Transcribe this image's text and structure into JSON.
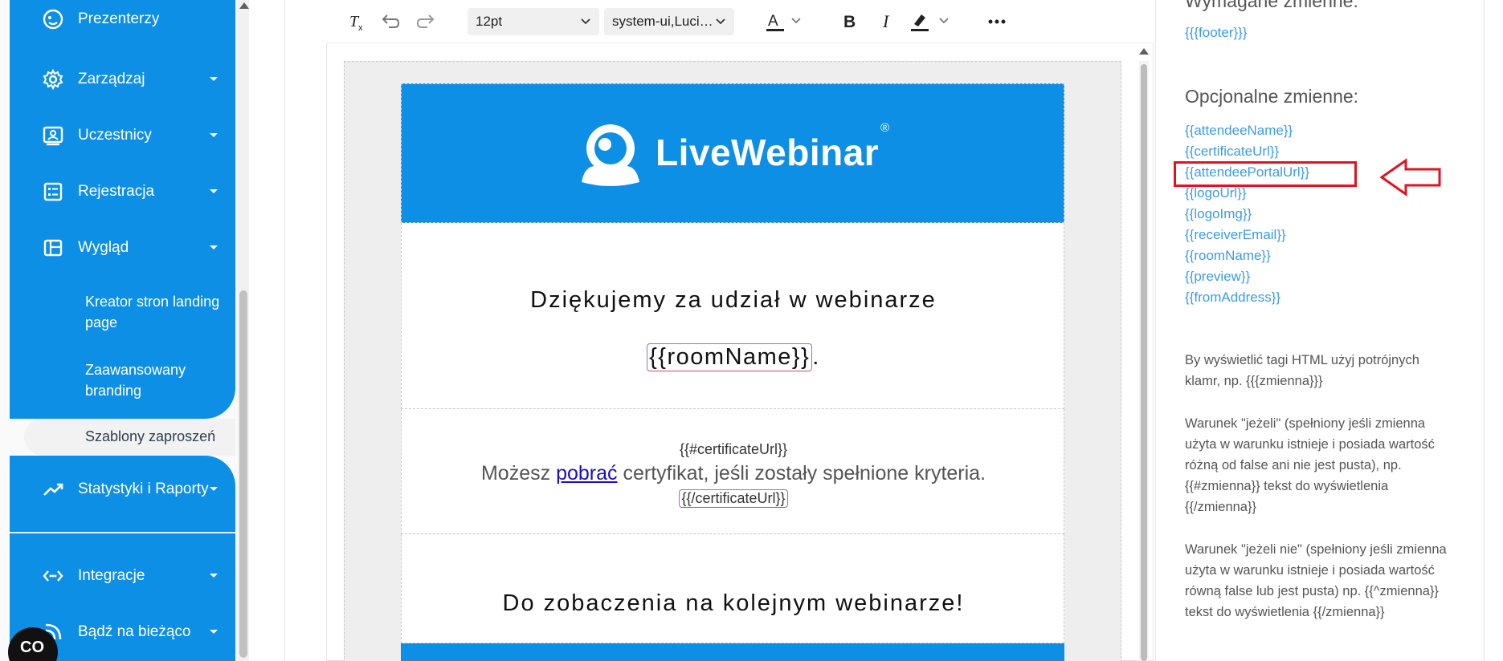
{
  "sidebar": {
    "items": [
      {
        "label": "Prezenterzy",
        "icon": "presenter-icon",
        "has_caret": false
      },
      {
        "label": "Zarządzaj",
        "icon": "gear-icon",
        "has_caret": true
      },
      {
        "label": "Uczestnicy",
        "icon": "participants-icon",
        "has_caret": true
      },
      {
        "label": "Rejestracja",
        "icon": "registration-form-icon",
        "has_caret": true
      },
      {
        "label": "Wygląd",
        "icon": "layout-icon",
        "has_caret": true
      }
    ],
    "subitems": [
      {
        "label": "Kreator stron landing page"
      },
      {
        "label": "Zaawansowany branding"
      },
      {
        "label": "Szablony zaproszeń",
        "active": true
      }
    ],
    "stats": {
      "label": "Statystyki i Raporty",
      "icon": "trending-up-icon"
    },
    "bottom_items": [
      {
        "label": "Integracje",
        "icon": "integrations-icon"
      },
      {
        "label": "Bądź na bieżąco",
        "icon": "rss-icon"
      }
    ],
    "chat_label": "CO",
    "accent": "#0d8fe5"
  },
  "toolbar": {
    "font_size": "12pt",
    "font_family": "system-ui,Luci…"
  },
  "email": {
    "brand": "LiveWebinar",
    "registered_mark": "®",
    "thanks": "Dziękujemy za udział w webinarze",
    "room_var": "{{roomName}}",
    "room_suffix": ".",
    "cert_open": "{{#certificateUrl}}",
    "cert_before": "Możesz ",
    "cert_link": "pobrać",
    "cert_after": " certyfikat, jeśli zostały spełnione kryteria.",
    "cert_close": "{{/certificateUrl}}",
    "goodbye": "Do zobaczenia na kolejnym webinarze!"
  },
  "right_panel": {
    "required_title": "Wymagane zmienne:",
    "required_vars": [
      "{{{footer}}}"
    ],
    "optional_title": "Opcjonalne zmienne:",
    "optional_vars": [
      "{{attendeeName}}",
      "{{certificateUrl}}",
      "{{attendeePortalUrl}}",
      "{{logoUrl}}",
      "{{logoImg}}",
      "{{receiverEmail}}",
      "{{roomName}}",
      "{{preview}}",
      "{{fromAddress}}"
    ],
    "help_1": "By wyświetlić tagi HTML użyj potrójnych klamr, np. {{{zmienna}}}",
    "help_2": "Warunek \"jeżeli\" (spełniony jeśli zmienna użyta w warunku istnieje i posiada wartość różną od false ani nie jest pusta), np. {{#zmienna}} tekst do wyświetlenia {{/zmienna}}",
    "help_3": "Warunek \"jeżeli nie\" (spełniony jeśli zmienna użyta w warunku istnieje i posiada wartość równą false lub jest pusta) np. {{^zmienna}} tekst do wyświetlenia {{/zmienna}}",
    "highlight_color": "#e0141e",
    "link_color": "#3d9be9"
  }
}
